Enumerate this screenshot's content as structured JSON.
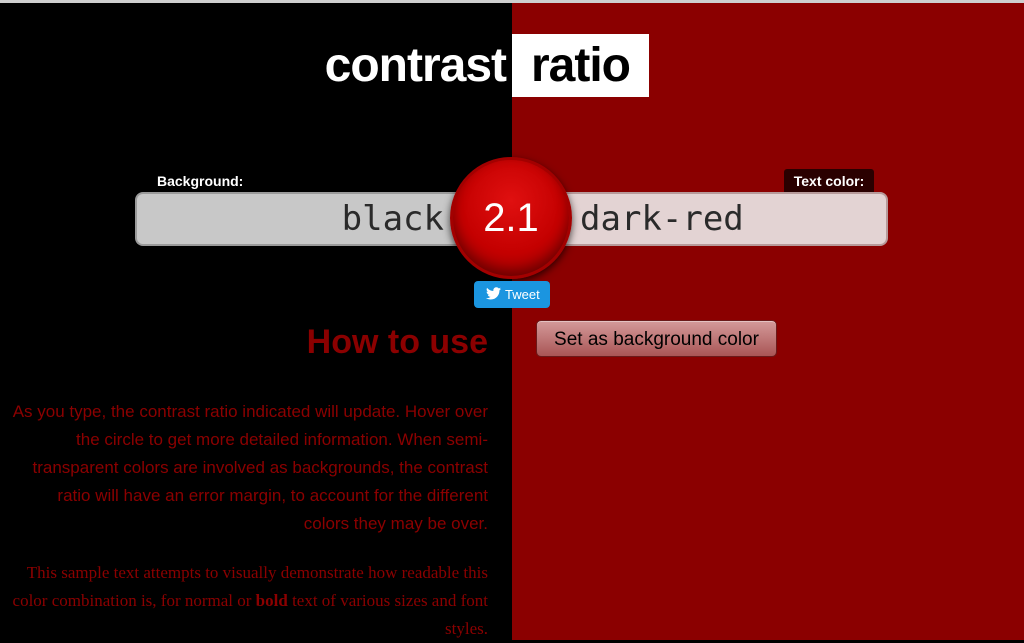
{
  "title": {
    "left": "contrast",
    "right": "ratio"
  },
  "labels": {
    "background": "Background:",
    "text_color": "Text color:"
  },
  "inputs": {
    "background_value": "black",
    "text_color_value": "dark-red"
  },
  "result": {
    "ratio": "2.1"
  },
  "tweet": {
    "label": "Tweet",
    "icon": "twitter-bird-icon"
  },
  "swap": {
    "label": "Set as background color"
  },
  "how": {
    "title": "How to use",
    "p1": "As you type, the contrast ratio indicated will update. Hover over the circle to get more detailed information. When semi-transparent colors are involved as backgrounds, the contrast ratio will have an error margin, to account for the different colors they may be over.",
    "p2_before": "This sample text attempts to visually demonstrate how readable this color combination is, for normal or",
    "p2_bold": "bold",
    "p2_after": "text of various sizes and font styles."
  },
  "colors": {
    "background": "#000000",
    "text": "#8b0000",
    "ratio_circle": "#c40000",
    "tweet": "#1b95e0"
  }
}
